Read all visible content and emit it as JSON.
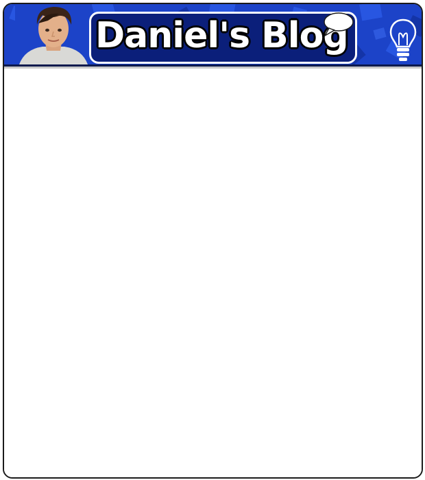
{
  "header": {
    "blog_title": "Daniel's Blog",
    "avatar_icon": "person-portrait",
    "speech_icon": "speech-bubble-icon",
    "idea_icon": "lightbulb-icon"
  },
  "colors": {
    "banner_blue": "#1c43c8",
    "title_box": "#0b1f7a",
    "border": "#1a1a1a",
    "page": "#ffffff"
  }
}
